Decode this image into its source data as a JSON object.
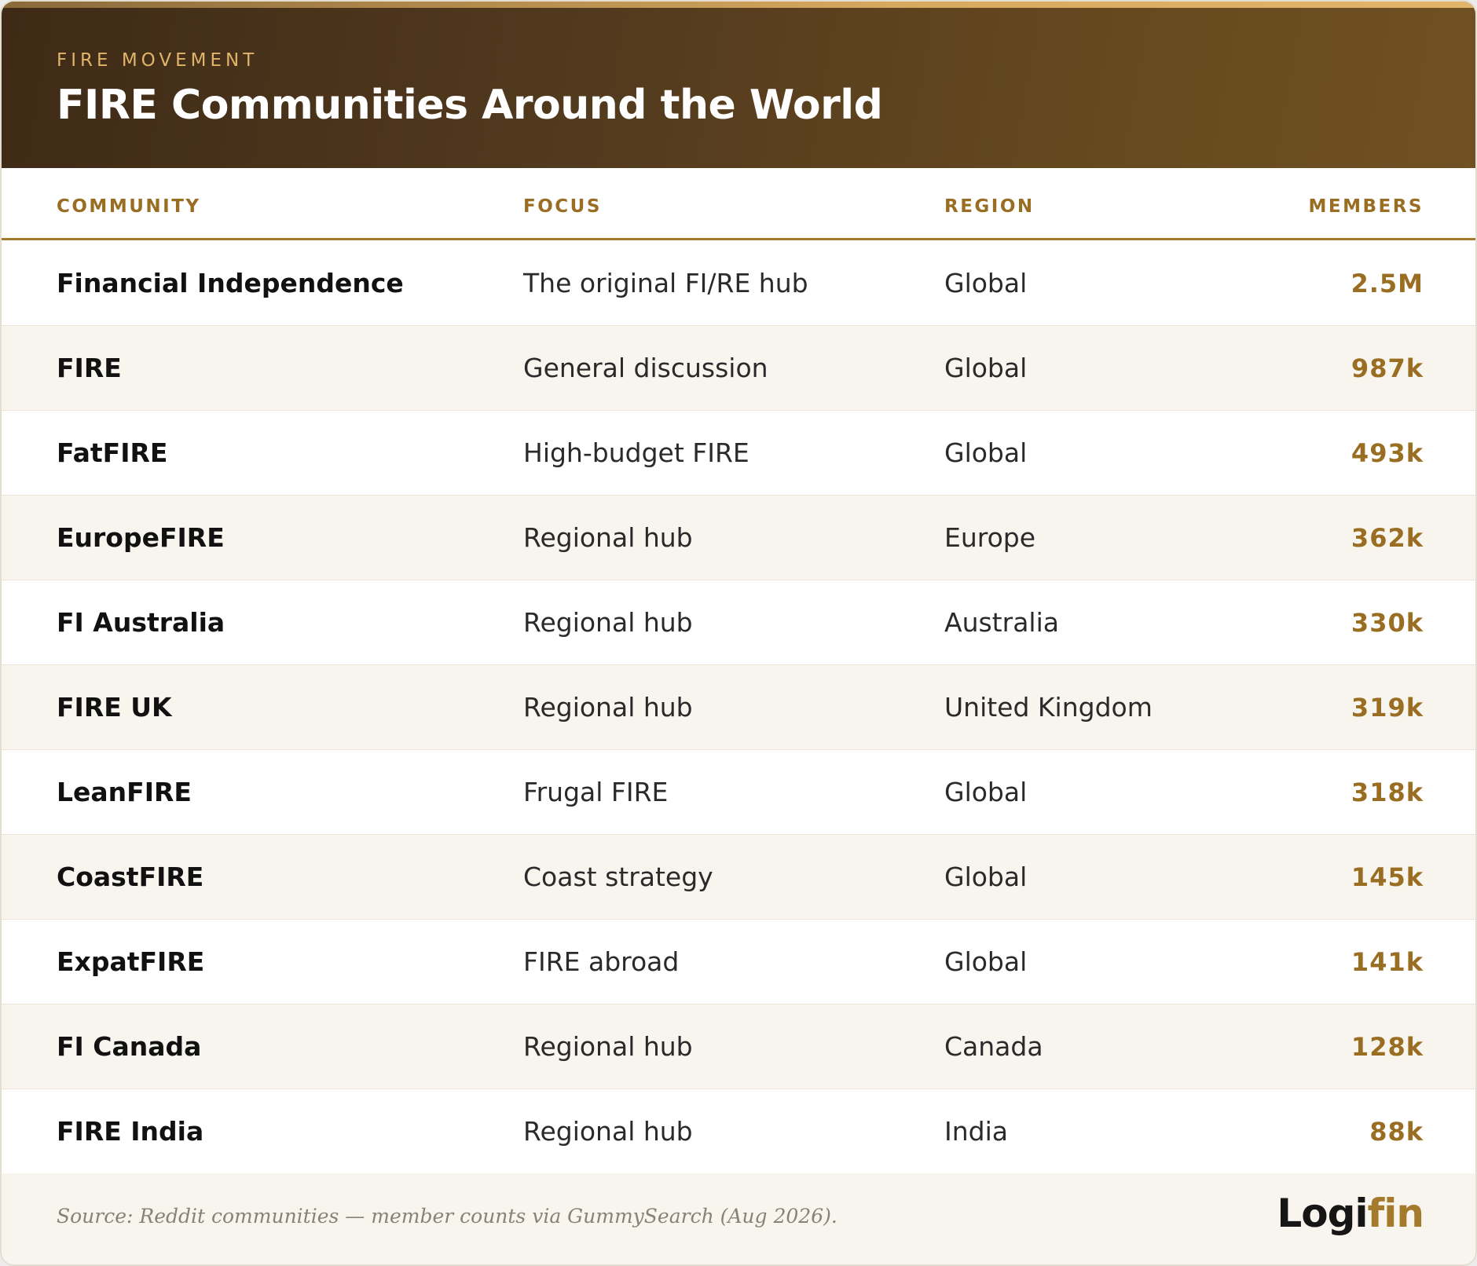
{
  "header": {
    "eyebrow": "FIRE MOVEMENT",
    "title": "FIRE Communities Around the World"
  },
  "table": {
    "columns": {
      "community": "COMMUNITY",
      "focus": "FOCUS",
      "region": "REGION",
      "members": "MEMBERS"
    },
    "rows": [
      {
        "community": "Financial Independence",
        "focus": "The original FI/RE hub",
        "region": "Global",
        "members": "2.5M"
      },
      {
        "community": "FIRE",
        "focus": "General discussion",
        "region": "Global",
        "members": "987k"
      },
      {
        "community": "FatFIRE",
        "focus": "High-budget FIRE",
        "region": "Global",
        "members": "493k"
      },
      {
        "community": "EuropeFIRE",
        "focus": "Regional hub",
        "region": "Europe",
        "members": "362k"
      },
      {
        "community": "FI Australia",
        "focus": "Regional hub",
        "region": "Australia",
        "members": "330k"
      },
      {
        "community": "FIRE UK",
        "focus": "Regional hub",
        "region": "United Kingdom",
        "members": "319k"
      },
      {
        "community": "LeanFIRE",
        "focus": "Frugal FIRE",
        "region": "Global",
        "members": "318k"
      },
      {
        "community": "CoastFIRE",
        "focus": "Coast strategy",
        "region": "Global",
        "members": "145k"
      },
      {
        "community": "ExpatFIRE",
        "focus": "FIRE abroad",
        "region": "Global",
        "members": "141k"
      },
      {
        "community": "FI Canada",
        "focus": "Regional hub",
        "region": "Canada",
        "members": "128k"
      },
      {
        "community": "FIRE India",
        "focus": "Regional hub",
        "region": "India",
        "members": "88k"
      }
    ]
  },
  "footer": {
    "source": "Source: Reddit communities — member counts via GummySearch (Aug 2026).",
    "brand_part1": "Logi",
    "brand_part2": "fin"
  },
  "colors": {
    "accent": "#a47a2c",
    "header_dark": "#3e2a16",
    "header_light": "#6f5124",
    "row_alt": "#f8f5ef"
  }
}
